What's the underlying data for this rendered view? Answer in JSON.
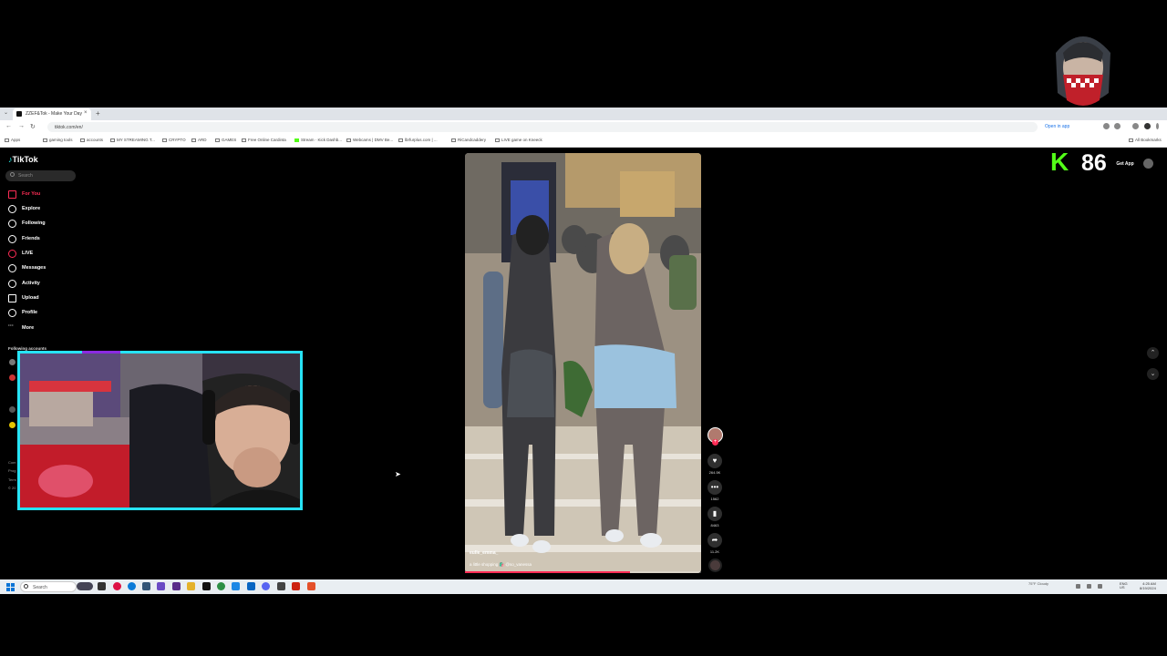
{
  "browser": {
    "tab_title": "ZZEF&Tok - Make Your Day",
    "tab_close": "×",
    "new_tab": "+",
    "url": "tiktok.com/en/",
    "open_in_app": "Open in app",
    "bookmarks": [
      "gaming tools",
      "accounts",
      "MY STREAMING T...",
      "CRYPTO",
      "ARD",
      "GAMES",
      "Free Online Cardinta",
      "Stream · Kick Dashb...",
      "Webcams | DMV Be...",
      "lbrfurplus.com | ...",
      "RiCandcaddery",
      "LIVE game on Kneeck"
    ],
    "all_bookmarks": "All Bookmarks",
    "apps": "Apps"
  },
  "sidebar": {
    "logo": "TikTok",
    "search_placeholder": "Search",
    "nav": [
      {
        "label": "For You",
        "icon": "home-icon",
        "active": true
      },
      {
        "label": "Explore",
        "icon": "compass-icon"
      },
      {
        "label": "Following",
        "icon": "following-icon"
      },
      {
        "label": "Friends",
        "icon": "friends-icon"
      },
      {
        "label": "LIVE",
        "icon": "live-icon"
      },
      {
        "label": "Messages",
        "icon": "messages-icon"
      },
      {
        "label": "Activity",
        "icon": "activity-icon"
      },
      {
        "label": "Upload",
        "icon": "upload-icon"
      },
      {
        "label": "Profile",
        "icon": "profile-icon"
      },
      {
        "label": "More",
        "icon": "more-icon"
      }
    ],
    "following_header": "Following accounts",
    "footer": [
      "Com",
      "Prog",
      "Term",
      "© 20"
    ]
  },
  "video": {
    "author": "eulle_emma_",
    "caption": "a little shopping 🛍️ @so_vanessa",
    "progress": 0.7
  },
  "actions": {
    "likes": "264.5K",
    "comments": "1562",
    "saves": "8463",
    "shares": "11.2K"
  },
  "header_right": {
    "get_app": "Get App"
  },
  "stream_overlay": {
    "kick_letter": "K",
    "viewer_count": "86"
  },
  "taskbar": {
    "search_placeholder": "Search",
    "weather": "75°F Cloudy",
    "clock_time": "4:25 AM",
    "clock_date": "8/19/2024",
    "lang": "ENG US"
  },
  "colors": {
    "accent_red": "#fe2c55",
    "webcam_border": "#27e3f5",
    "kick_green": "#53fc18"
  }
}
